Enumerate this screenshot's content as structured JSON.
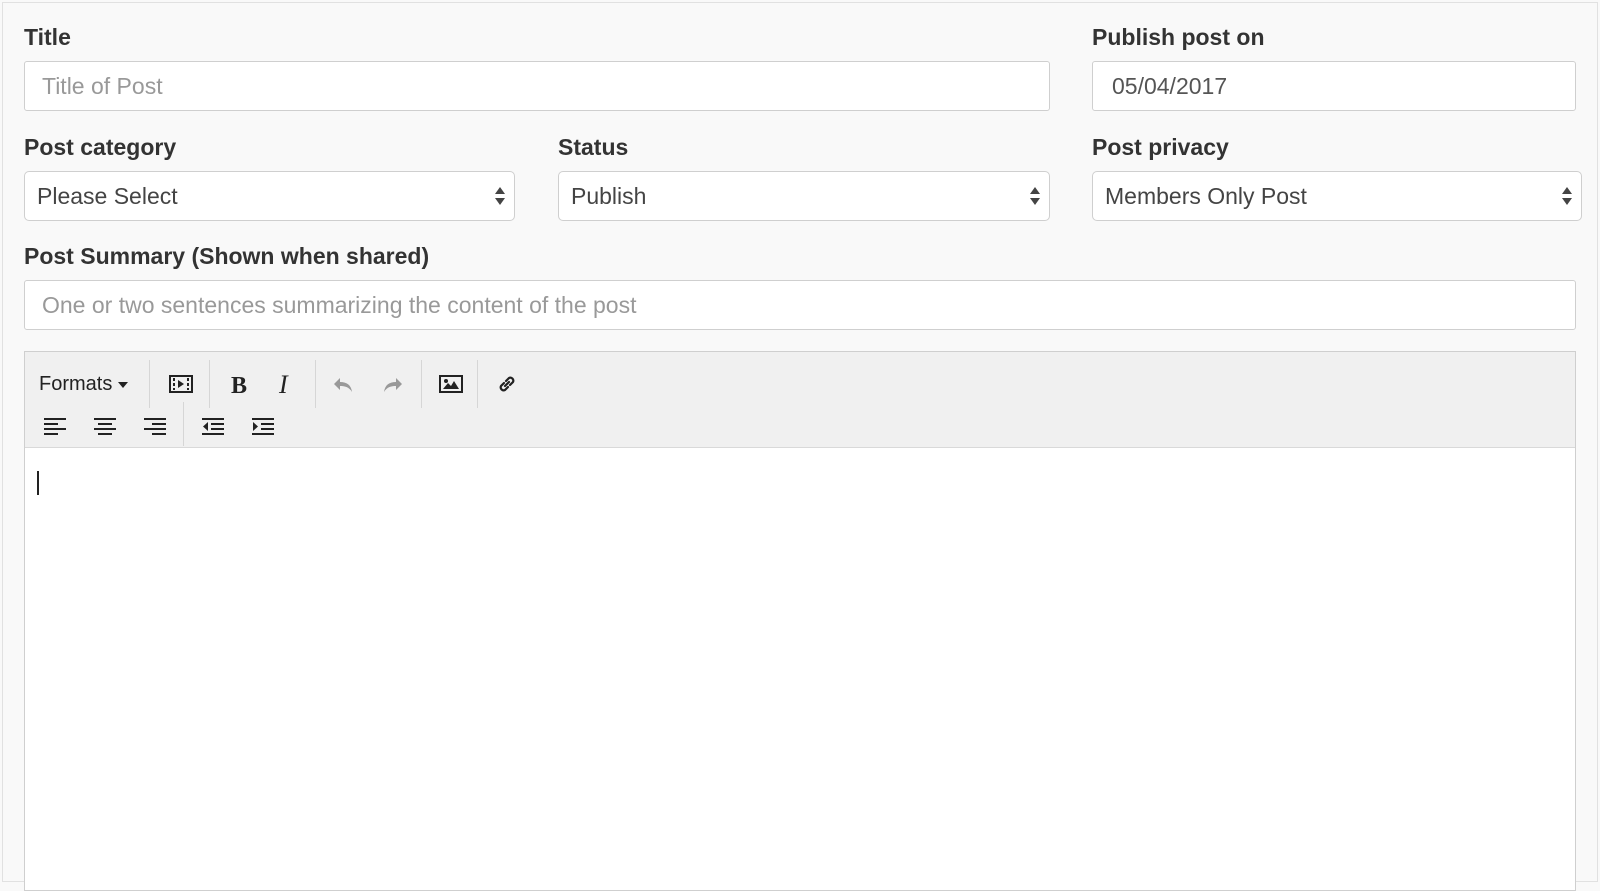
{
  "form": {
    "title": {
      "label": "Title",
      "placeholder": "Title of Post",
      "value": ""
    },
    "publish_date": {
      "label": "Publish post on",
      "value": "05/04/2017"
    },
    "category": {
      "label": "Post category",
      "selected": "Please Select"
    },
    "status": {
      "label": "Status",
      "selected": "Publish"
    },
    "privacy": {
      "label": "Post privacy",
      "selected": "Members Only Post"
    },
    "summary": {
      "label": "Post Summary (Shown when shared)",
      "placeholder": "One or two sentences summarizing the content of the post",
      "value": ""
    }
  },
  "editor": {
    "formats_label": "Formats",
    "toolbar_row1": [
      "media-icon",
      "bold-icon",
      "italic-icon",
      "undo-icon",
      "redo-icon",
      "image-icon",
      "link-icon"
    ],
    "toolbar_row2": [
      "align-left-icon",
      "align-center-icon",
      "align-right-icon",
      "outdent-icon",
      "indent-icon"
    ],
    "content": ""
  },
  "colors": {
    "background": "#f9f9f9",
    "toolbar": "#f0f0f0",
    "border": "#cfcfcf",
    "label": "#333333",
    "placeholder": "#999999"
  }
}
